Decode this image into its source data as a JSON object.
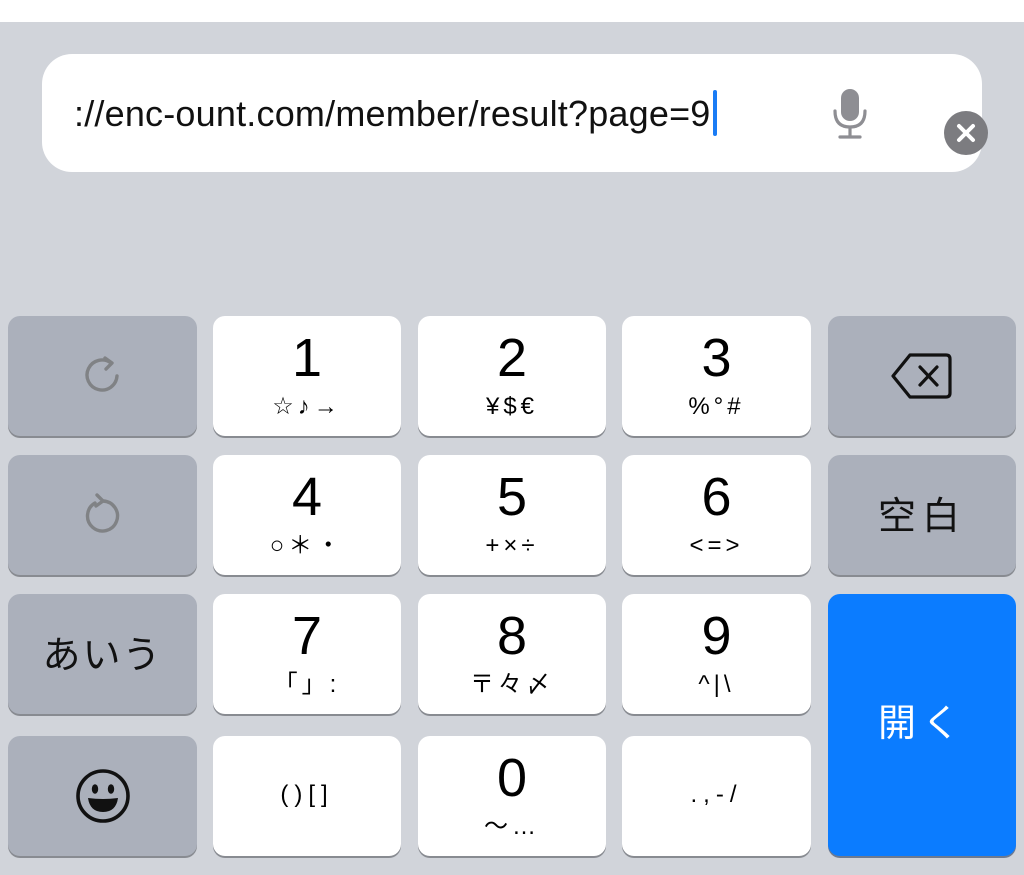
{
  "url_bar": {
    "value": "://enc-ount.com/member/result?page=9",
    "mic_icon": "microphone-icon",
    "clear_icon": "clear-circle-x-icon"
  },
  "keyboard": {
    "redo_icon": "redo-icon",
    "undo_icon": "undo-icon",
    "mode_label": "あいう",
    "emoji_icon": "emoji-smiley-icon",
    "keys": [
      {
        "main": "1",
        "sub": "☆♪→"
      },
      {
        "main": "2",
        "sub": "¥$€"
      },
      {
        "main": "3",
        "sub": "%°#"
      },
      {
        "main": "4",
        "sub": "○＊・"
      },
      {
        "main": "5",
        "sub": "+×÷"
      },
      {
        "main": "6",
        "sub": "<=>"
      },
      {
        "main": "7",
        "sub": "「」:"
      },
      {
        "main": "8",
        "sub": "〒々〆"
      },
      {
        "main": "9",
        "sub": "^|\\"
      },
      {
        "main": "",
        "sub": "()[]"
      },
      {
        "main": "0",
        "sub": "〜…"
      },
      {
        "main": "",
        "sub": ".,-/"
      }
    ],
    "delete_icon": "delete-backspace-icon",
    "space_label": "空白",
    "return_label": "開く"
  },
  "colors": {
    "keyboard_bg": "#d1d4da",
    "key_light": "#ffffff",
    "key_dark": "#abb0bb",
    "accent": "#0b7cff",
    "cursor": "#1a7cf5"
  }
}
